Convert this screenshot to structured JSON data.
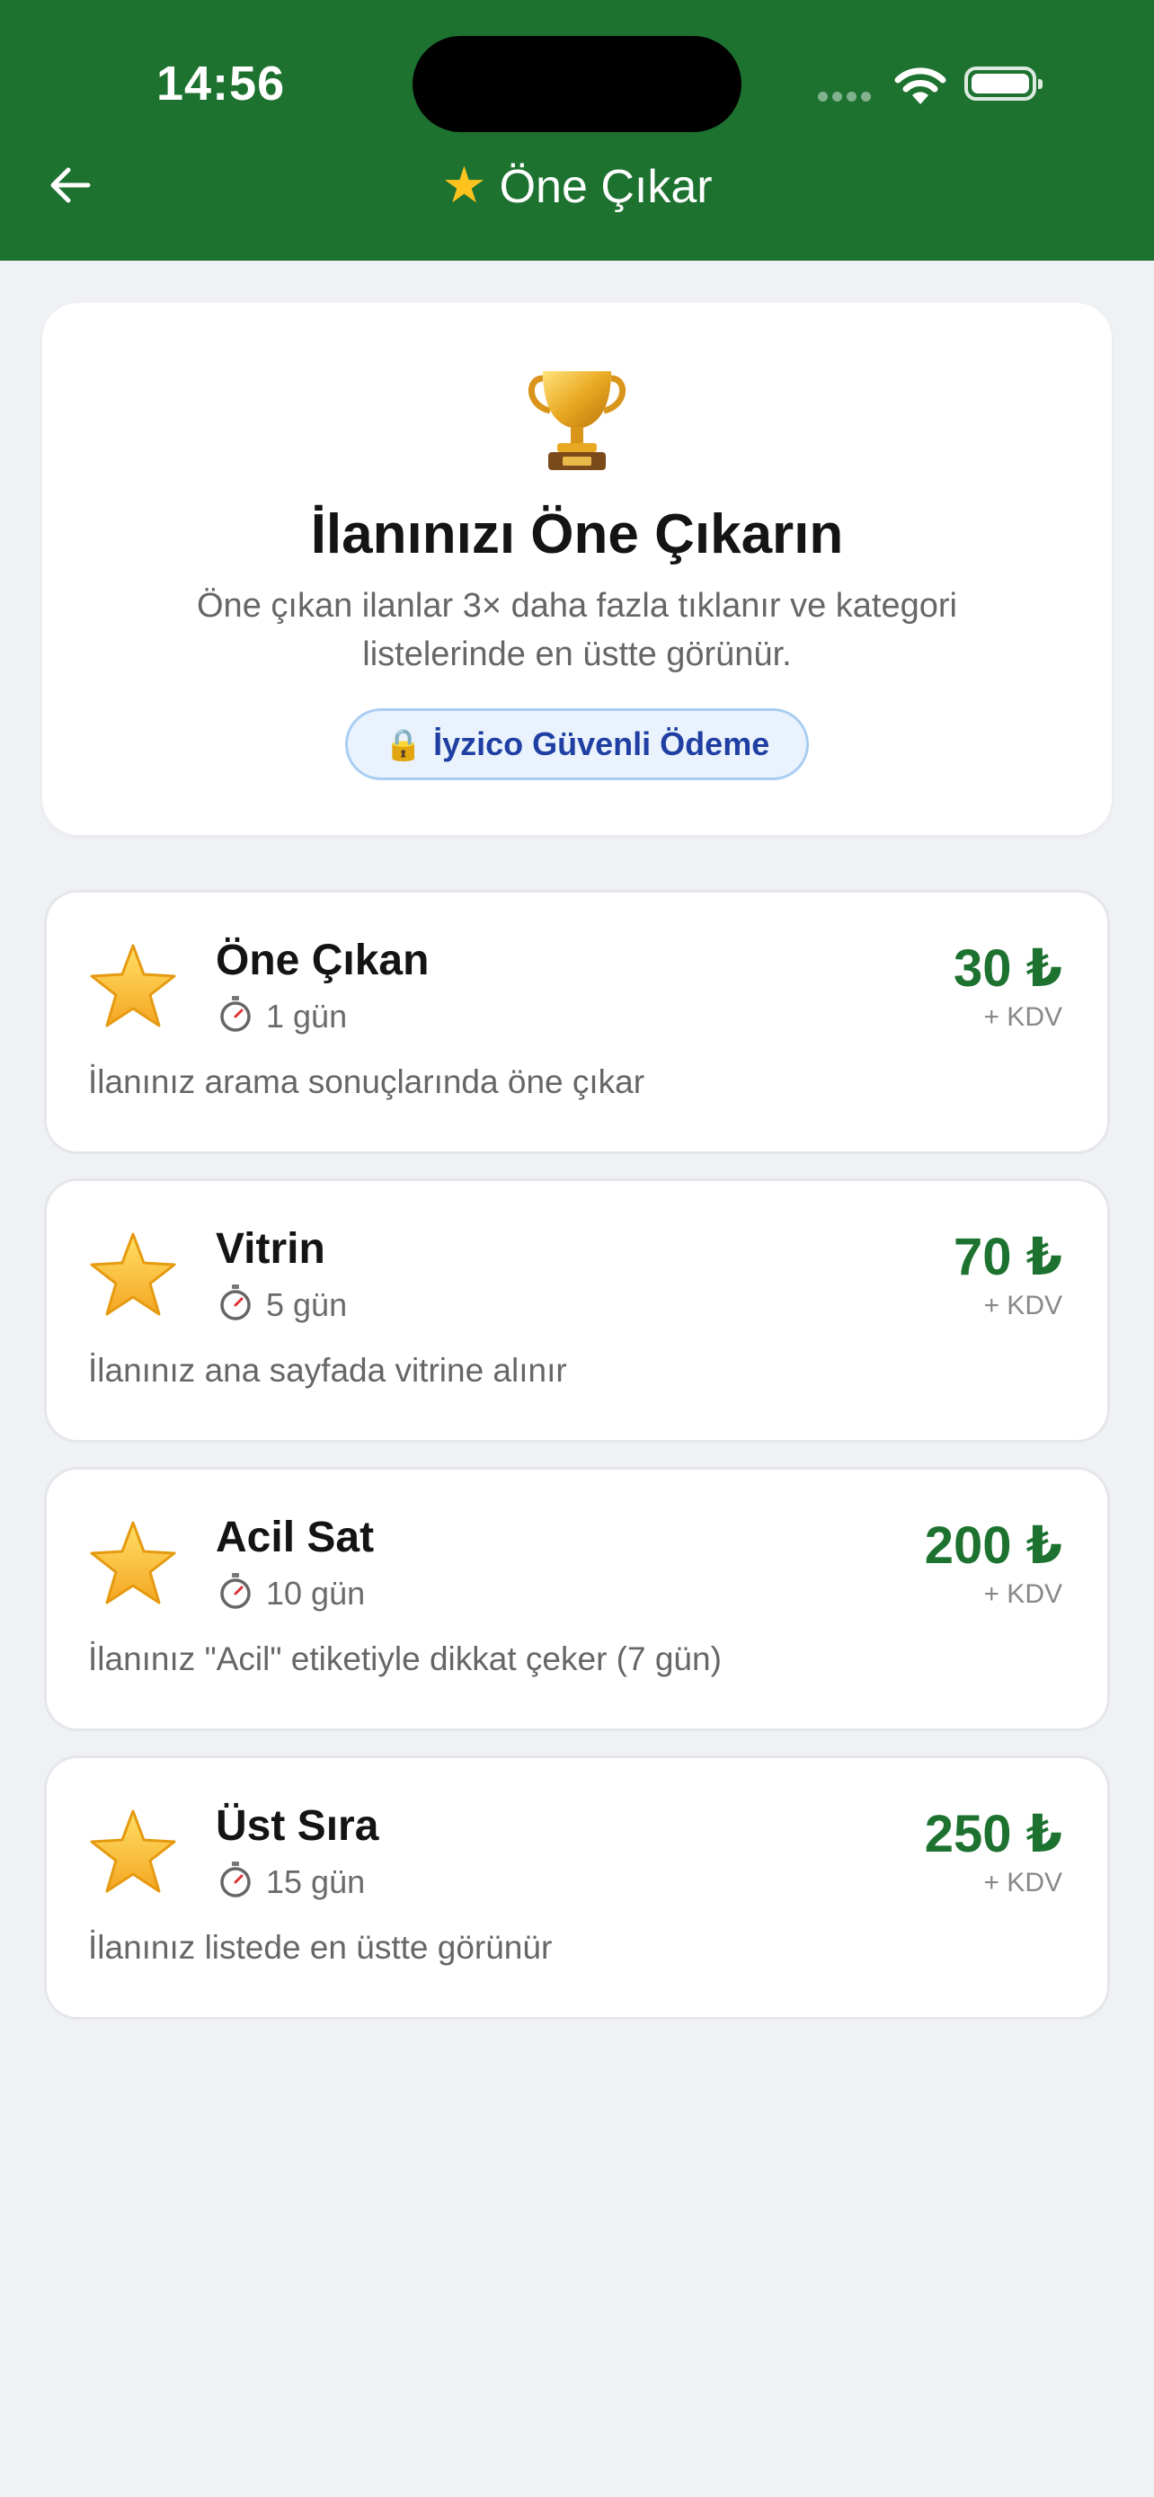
{
  "status_bar": {
    "time": "14:56"
  },
  "nav": {
    "title": "Öne Çıkar",
    "back_icon": "arrow-left-icon"
  },
  "hero": {
    "icon": "trophy-icon",
    "title": "İlanınızı Öne Çıkarın",
    "description": "Öne çıkan ilanlar 3× daha fazla tıklanır ve kategori listelerinde en üstte görünür.",
    "secure_label": "İyzico Güvenli Ödeme"
  },
  "colors": {
    "brand_green": "#1d7230",
    "background": "#eff1f5",
    "badge_text": "#1f3fa3",
    "badge_border": "#a9cdf3"
  },
  "plans": [
    {
      "name": "Öne Çıkan",
      "duration": "1 gün",
      "price": "30 ₺",
      "vat": "+ KDV",
      "description": "İlanınız arama sonuçlarında öne çıkar"
    },
    {
      "name": "Vitrin",
      "duration": "5 gün",
      "price": "70 ₺",
      "vat": "+ KDV",
      "description": "İlanınız ana sayfada vitrine alınır"
    },
    {
      "name": "Acil Sat",
      "duration": "10 gün",
      "price": "200 ₺",
      "vat": "+ KDV",
      "description": "İlanınız \"Acil\" etiketiyle dikkat çeker (7 gün)"
    },
    {
      "name": "Üst Sıra",
      "duration": "15 gün",
      "price": "250 ₺",
      "vat": "+ KDV",
      "description": "İlanınız listede en üstte görünür"
    }
  ]
}
